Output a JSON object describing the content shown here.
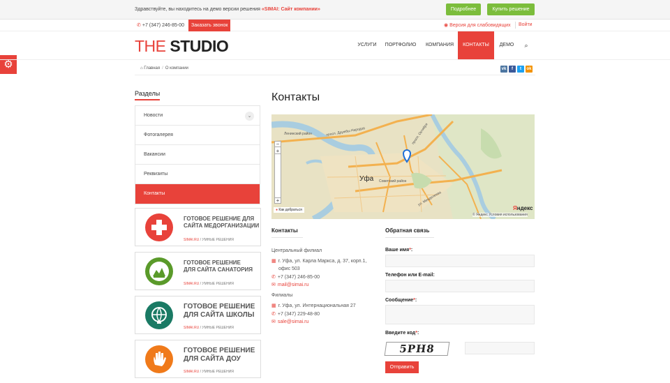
{
  "topbar": {
    "message_prefix": "Здравствуйте, вы находитесь на демо версии решения ",
    "message_link": "«SIMAI: Сайт компании»",
    "more_button": "Подробнее",
    "buy_button": "Купить решение"
  },
  "subbar": {
    "phone": "+7 (347) 246-85-00",
    "call_button": "Заказать звонок",
    "accessibility": "Версия для слабовидящих",
    "login": "Войти"
  },
  "header": {
    "logo_the": "THE",
    "logo_studio": "STUDIO",
    "nav": [
      "УСЛУГИ",
      "ПОРТФОЛИО",
      "КОМПАНИЯ",
      "КОНТАКТЫ",
      "ДЕМО"
    ],
    "active_nav": "КОНТАКТЫ"
  },
  "breadcrumb": {
    "home": "Главная",
    "current": "О компании"
  },
  "share": {
    "vk": "vk",
    "fb": "f",
    "tw": "t",
    "ok": "ok",
    "colors": {
      "vk": "#4d76a1",
      "fb": "#3b5998",
      "tw": "#1da1f2",
      "ok": "#f39200"
    }
  },
  "sidebar": {
    "title": "Разделы",
    "items": [
      "Новости",
      "Фотогалерея",
      "Вакансии",
      "Реквизиты",
      "Контакты"
    ],
    "active": "Контакты"
  },
  "banners": [
    {
      "title": "ГОТОВОЕ РЕШЕНИЕ ДЛЯ\nСАЙТА МЕДОРГАНИЗАЦИИ",
      "site": "SIMAI.RU",
      "tail": " / УМНЫЕ РЕШЕНИЯ",
      "color": "#e8423a",
      "icon": "medical-cross-icon"
    },
    {
      "title": "ГОТОВОЕ РЕШЕНИЕ\nДЛЯ САЙТА САНАТОРИЯ",
      "site": "SIMAI.RU",
      "tail": " / УМНЫЕ РЕШЕНИЯ",
      "color": "#5a9a2a",
      "icon": "sanatorium-icon"
    },
    {
      "title": "ГОТОВОЕ РЕШЕНИЕ\nДЛЯ САЙТА ШКОЛЫ",
      "site": "SIMAI.RU",
      "tail": " / УМНЫЕ РЕШЕНИЯ",
      "color": "#1a7a64",
      "icon": "globe-icon"
    },
    {
      "title": "ГОТОВОЕ РЕШЕНИЕ\nДЛЯ САЙТА ДОУ",
      "site": "SIMAI.RU",
      "tail": " / УМНЫЕ РЕШЕНИЯ",
      "color": "#f07a1a",
      "icon": "hand-icon"
    }
  ],
  "main": {
    "title": "Контакты"
  },
  "map": {
    "city": "Уфа",
    "labels": [
      "просп. Дружбы Народов",
      "Ленинский район",
      "Советский район",
      "просп. Октября",
      "ул. Менделеева"
    ],
    "route_button": "Как добраться",
    "brand_y": "Я",
    "brand_rest": "ндекс",
    "copyright": "© Яндекс  Условия использования"
  },
  "contacts": {
    "heading": "Контакты",
    "branch1_title": "Центральный филиал",
    "branch1_address_l1": "г. Уфа, ул. Карла Маркса, д. 37, корп.1,",
    "branch1_address_l2": "офис 503",
    "branch1_phone": "+7 (347) 246-85-00",
    "branch1_email": "mail@simai.ru",
    "branch2_title": "Филиалы",
    "branch2_address": "г. Уфа, ул. Интернациональная 27",
    "branch2_phone": "+7 (347) 229-48-80",
    "branch2_email": "sale@simai.ru"
  },
  "feedback": {
    "heading": "Обратная связь",
    "name_label": "Ваше имя",
    "contact_label": "Телефон или E-mail:",
    "message_label": "Сообщение",
    "code_label": "Введите код",
    "req_mark": "*",
    "colon": ":",
    "captcha_text": "5PH8",
    "send_button": "Отправить"
  }
}
